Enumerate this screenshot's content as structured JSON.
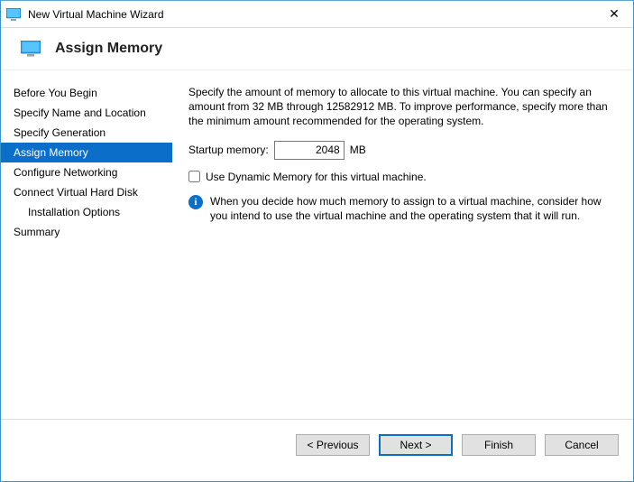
{
  "window": {
    "title": "New Virtual Machine Wizard"
  },
  "header": {
    "title": "Assign Memory"
  },
  "sidebar": {
    "items": [
      {
        "label": "Before You Begin"
      },
      {
        "label": "Specify Name and Location"
      },
      {
        "label": "Specify Generation"
      },
      {
        "label": "Assign Memory"
      },
      {
        "label": "Configure Networking"
      },
      {
        "label": "Connect Virtual Hard Disk"
      },
      {
        "label": "Installation Options"
      },
      {
        "label": "Summary"
      }
    ]
  },
  "content": {
    "description": "Specify the amount of memory to allocate to this virtual machine. You can specify an amount from 32 MB through 12582912 MB. To improve performance, specify more than the minimum amount recommended for the operating system.",
    "startup_label": "Startup memory:",
    "startup_value": "2048",
    "startup_unit": "MB",
    "dynamic_label": "Use Dynamic Memory for this virtual machine.",
    "info_text": "When you decide how much memory to assign to a virtual machine, consider how you intend to use the virtual machine and the operating system that it will run."
  },
  "footer": {
    "previous": "< Previous",
    "next": "Next >",
    "finish": "Finish",
    "cancel": "Cancel"
  }
}
